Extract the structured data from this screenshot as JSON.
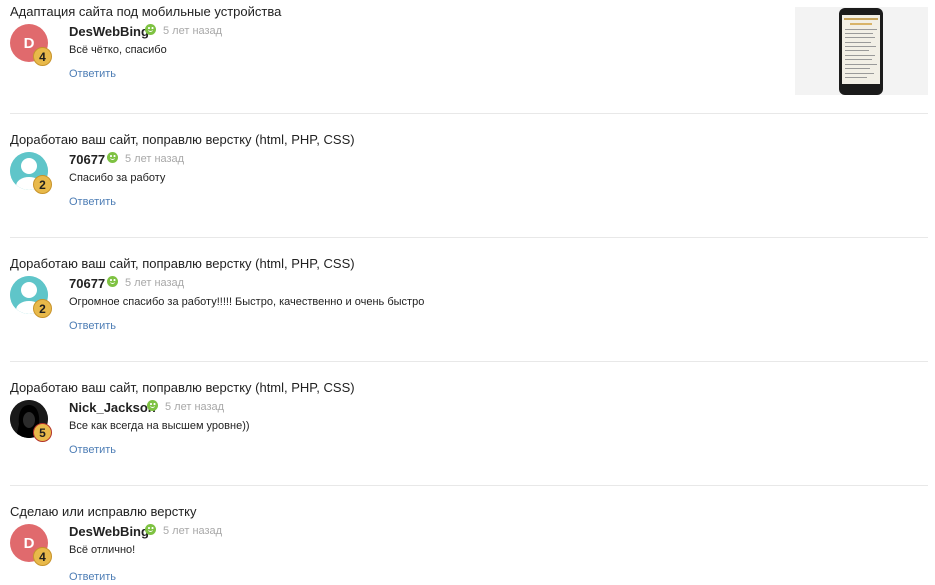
{
  "reviews": [
    {
      "title": "Адаптация сайта под мобильные устройства",
      "user": "DesWebBing",
      "time": "5 лет назад",
      "text": "Всё чётко, спасибо",
      "reply": "Ответить",
      "avatar_letter": "D",
      "avatar_color": "#e06a6d",
      "level": "4"
    },
    {
      "title": "Доработаю ваш сайт, поправлю верстку (html, PHP, CSS)",
      "user": "70677",
      "time": "5 лет назад",
      "text": "Спасибо за работу",
      "reply": "Ответить",
      "avatar_letter": "",
      "avatar_color": "#5fc5c9",
      "level": "2"
    },
    {
      "title": "Доработаю ваш сайт, поправлю верстку (html, PHP, CSS)",
      "user": "70677",
      "time": "5 лет назад",
      "text": "Огромное спасибо за работу!!!!! Быстро, качественно и очень быстро",
      "reply": "Ответить",
      "avatar_letter": "",
      "avatar_color": "#5fc5c9",
      "level": "2"
    },
    {
      "title": "Доработаю ваш сайт, поправлю верстку (html, PHP, CSS)",
      "user": "Nick_Jackson",
      "time": "5 лет назад",
      "text": "Все как всегда на высшем уровне))",
      "reply": "Ответить",
      "avatar_letter": "",
      "avatar_color": "#111111",
      "level": "5"
    },
    {
      "title": "Сделаю или исправлю верстку",
      "user": "DesWebBing",
      "time": "5 лет назад",
      "text": "Всё отлично!",
      "reply": "Ответить",
      "avatar_letter": "D",
      "avatar_color": "#e06a6d",
      "level": "4"
    }
  ],
  "icons": {
    "online": "smiley-icon",
    "thumbnail": "mobile-site-preview"
  },
  "colors": {
    "link": "#4d7db5",
    "time": "#a8a8a8",
    "online": "#7ec242",
    "badge": "#e8b94a"
  }
}
